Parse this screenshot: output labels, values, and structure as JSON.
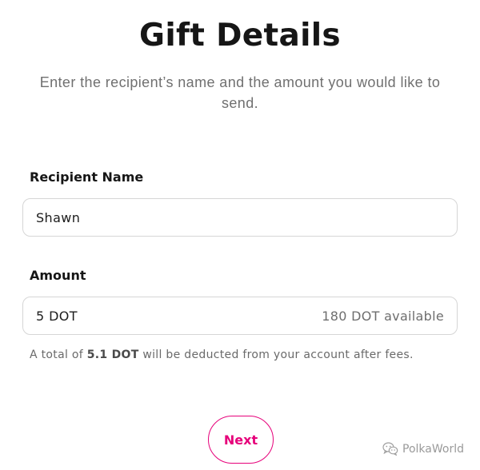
{
  "header": {
    "title": "Gift Details",
    "subtitle": "Enter the recipient’s name and the amount you would like to send."
  },
  "recipient": {
    "label": "Recipient Name",
    "value": "Shawn"
  },
  "amount": {
    "label": "Amount",
    "value": "5 DOT",
    "available": "180 DOT available"
  },
  "fee_note": {
    "prefix": "A total of ",
    "total": "5.1 DOT",
    "suffix": " will be deducted from your account after fees."
  },
  "actions": {
    "next_label": "Next"
  },
  "watermark": {
    "text": "PolkaWorld",
    "icon": "wechat-icon"
  },
  "colors": {
    "accent": "#e6007a",
    "title": "#161616",
    "muted": "#707070",
    "border": "#d6d6d6"
  }
}
